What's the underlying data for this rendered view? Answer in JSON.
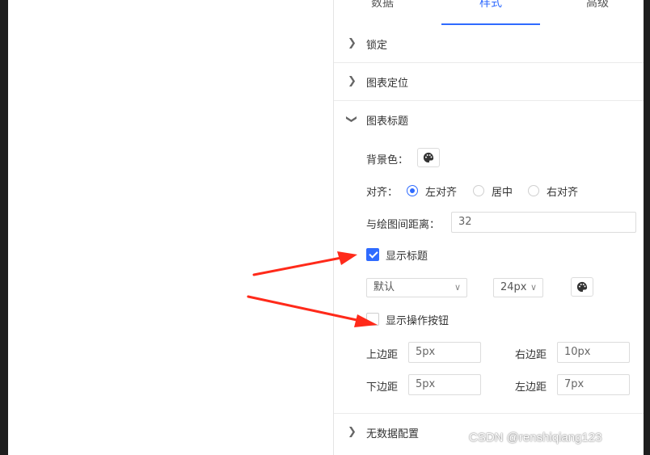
{
  "tabs": [
    {
      "label": "数据",
      "active": false
    },
    {
      "label": "样式",
      "active": true
    },
    {
      "label": "高级",
      "active": false
    }
  ],
  "sections": {
    "lock": {
      "title": "锁定",
      "expanded": false
    },
    "chart_position": {
      "title": "图表定位",
      "expanded": false
    },
    "chart_title": {
      "title": "图表标题",
      "expanded": true
    },
    "no_data": {
      "title": "无数据配置",
      "expanded": false
    }
  },
  "title_settings": {
    "background_label": "背景色：",
    "align_label": "对齐：",
    "align_options": [
      "左对齐",
      "居中",
      "右对齐"
    ],
    "align_selected": "左对齐",
    "distance_label": "与绘图间距离：",
    "distance_value": "32",
    "show_title_label": "显示标题",
    "show_title_checked": true,
    "font_family_value": "默认",
    "font_size_value": "24px",
    "show_action_buttons_label": "显示操作按钮",
    "show_action_buttons_checked": false,
    "padding": {
      "top_label": "上边距",
      "top_value": "5px",
      "right_label": "右边距",
      "right_value": "10px",
      "bottom_label": "下边距",
      "bottom_value": "5px",
      "left_label": "左边距",
      "left_value": "7px"
    }
  },
  "colors": {
    "accent": "#2f6bff",
    "annotation_arrow": "#ff2a1a"
  },
  "watermark": "CSDN @renshiqiang123"
}
